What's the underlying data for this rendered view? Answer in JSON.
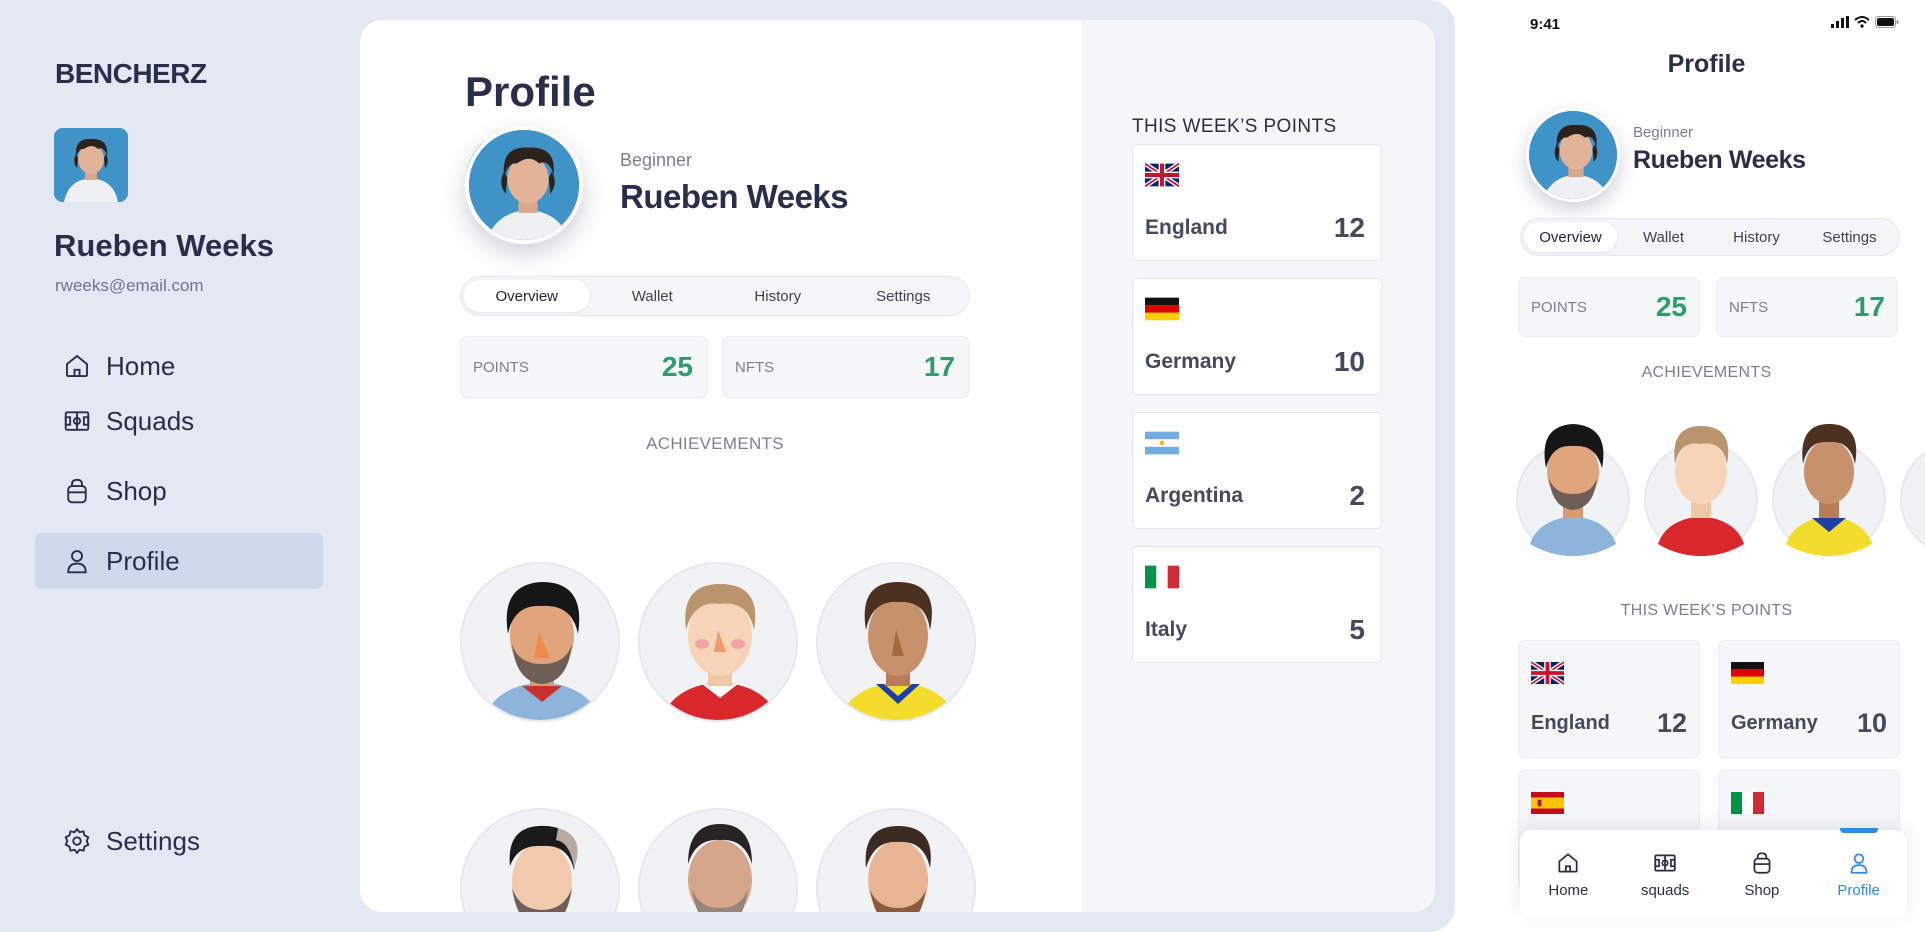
{
  "brand": "BENCHERZ",
  "user": {
    "name": "Rueben Weeks",
    "email": "rweeks@email.com",
    "level": "Beginner"
  },
  "sidebar": {
    "items": [
      {
        "label": "Home",
        "icon": "home-icon"
      },
      {
        "label": "Squads",
        "icon": "squads-icon"
      },
      {
        "label": "Shop",
        "icon": "shop-icon"
      },
      {
        "label": "Profile",
        "icon": "profile-icon",
        "active": true
      }
    ],
    "settings": {
      "label": "Settings",
      "icon": "gear-icon"
    }
  },
  "page": {
    "title": "Profile"
  },
  "tabs": [
    {
      "label": "Overview",
      "active": true
    },
    {
      "label": "Wallet"
    },
    {
      "label": "History"
    },
    {
      "label": "Settings"
    }
  ],
  "stats": {
    "points": {
      "label": "POINTS",
      "value": "25"
    },
    "nfts": {
      "label": "NFTS",
      "value": "17"
    }
  },
  "achievements": {
    "title": "ACHIEVEMENTS"
  },
  "week_points": {
    "title": "THIS WEEK’S POINTS",
    "mobile_title": "THIS WEEK’S POINTS",
    "items": [
      {
        "country": "England",
        "points": "12",
        "flag": "uk-flag-icon"
      },
      {
        "country": "Germany",
        "points": "10",
        "flag": "germany-flag-icon"
      },
      {
        "country": "Argentina",
        "points": "2",
        "flag": "argentina-flag-icon"
      },
      {
        "country": "Italy",
        "points": "5",
        "flag": "italy-flag-icon"
      }
    ]
  },
  "mobile": {
    "time": "9:41",
    "title": "Profile",
    "bottom_nav": [
      {
        "label": "Home"
      },
      {
        "label": "squads"
      },
      {
        "label": "Shop"
      },
      {
        "label": "Profile",
        "active": true
      }
    ]
  },
  "colors": {
    "accent_green": "#2f9c6e",
    "active_blue": "#2e8ae6",
    "sidebar_bg": "#e3e8f2",
    "nav_active_bg": "#cfd9ec"
  }
}
